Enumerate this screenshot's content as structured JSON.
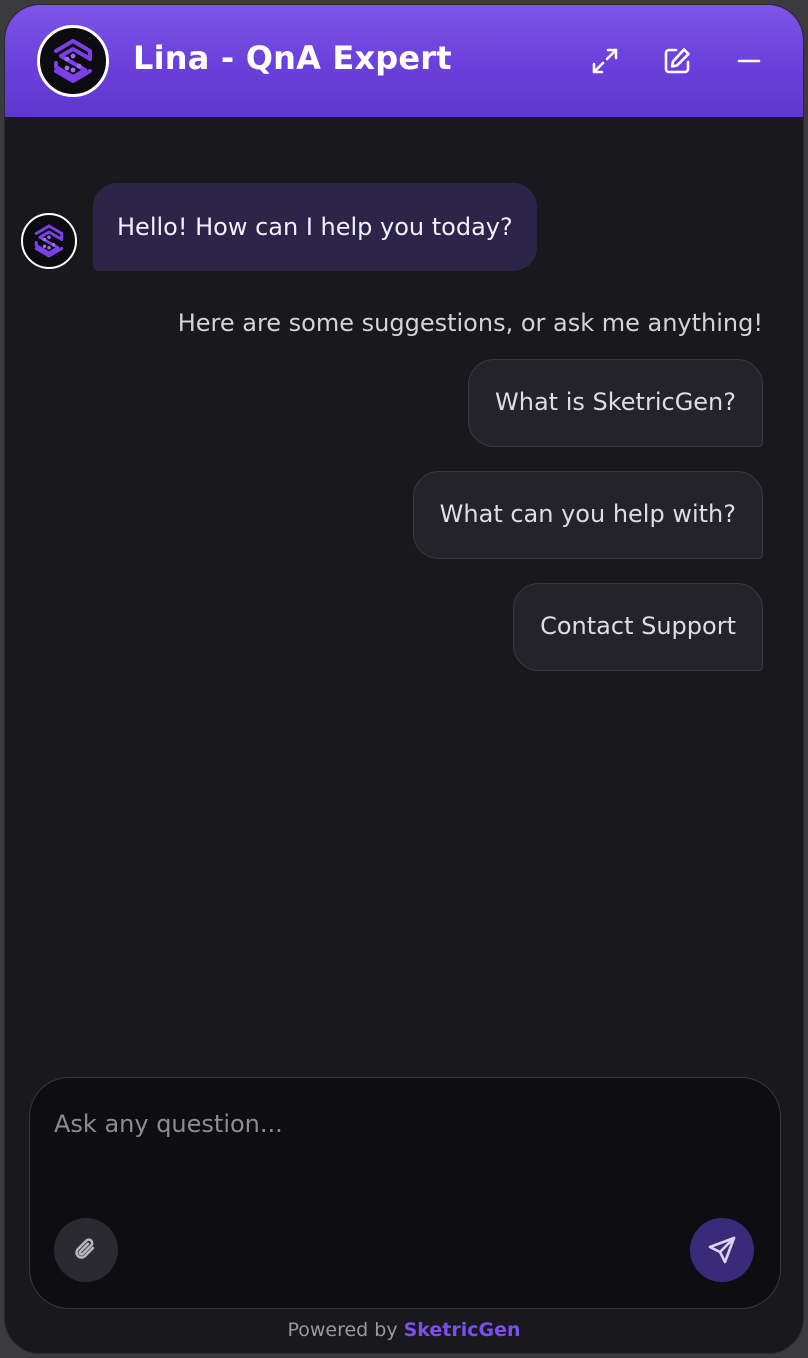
{
  "header": {
    "title": "Lina - QnA Expert",
    "avatar_icon": "sketricgen-logo-icon",
    "expand_icon": "expand-icon",
    "edit_icon": "edit-icon",
    "minimize_icon": "minimize-icon"
  },
  "conversation": {
    "bot_greeting": "Hello! How can I help you today?",
    "suggestions_intro": "Here are some suggestions, or ask me anything!",
    "suggestions": [
      "What is SketricGen?",
      "What can you help with?",
      "Contact Support"
    ]
  },
  "composer": {
    "placeholder": "Ask any question...",
    "value": "",
    "attach_icon": "paperclip-icon",
    "send_icon": "send-icon"
  },
  "footer": {
    "prefix": "Powered by",
    "brand": "SketricGen"
  },
  "colors": {
    "header_gradient_top": "#7d55e8",
    "header_gradient_bottom": "#5f36cf",
    "background": "#19181d",
    "bot_bubble": "#2c2449",
    "accent": "#7c4ff0",
    "send_button": "#3a2a7a"
  }
}
